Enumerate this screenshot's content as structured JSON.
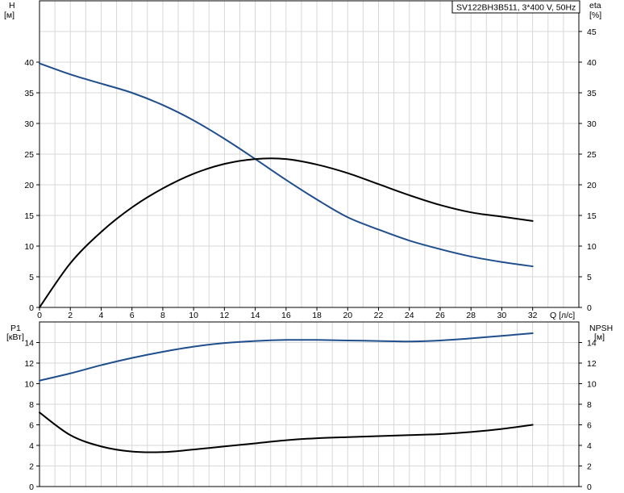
{
  "chart_data": [
    {
      "type": "line",
      "title": "SV122BH3B511, 3*400 V, 50Hz",
      "ylabel_left": "H",
      "ylabel_left_unit": "[м]",
      "ylabel_right": "eta",
      "ylabel_right_unit": "[%]",
      "xlabel": "Q [л/с]",
      "xlim": [
        0,
        35
      ],
      "ylim_left": [
        0,
        50
      ],
      "ylim_right": [
        0,
        50
      ],
      "x_ticks": [
        "0",
        "2",
        "4",
        "6",
        "8",
        "10",
        "12",
        "14",
        "16",
        "18",
        "20",
        "22",
        "24",
        "26",
        "28",
        "30",
        "32"
      ],
      "y_left_ticks": [
        "0",
        "5",
        "10",
        "15",
        "20",
        "25",
        "30",
        "35",
        "40"
      ],
      "y_right_ticks": [
        "0",
        "5",
        "10",
        "15",
        "20",
        "25",
        "30",
        "35",
        "40",
        "45"
      ],
      "grid": true,
      "series": [
        {
          "key": "H",
          "color": "#1f4e8c",
          "axis": "left",
          "x": [
            0,
            2,
            4,
            6,
            8,
            10,
            12,
            14,
            16,
            18,
            20,
            22,
            24,
            26,
            28,
            30,
            32
          ],
          "y": [
            39.8,
            38.0,
            36.5,
            35.0,
            33.0,
            30.5,
            27.5,
            24.2,
            20.8,
            17.6,
            14.7,
            12.7,
            10.9,
            9.5,
            8.3,
            7.4,
            6.7
          ]
        },
        {
          "key": "eta",
          "color": "#000000",
          "axis": "right",
          "x": [
            0,
            2,
            4,
            6,
            8,
            10,
            12,
            14,
            16,
            18,
            20,
            22,
            24,
            26,
            28,
            30,
            32
          ],
          "y": [
            0,
            7.2,
            12.3,
            16.3,
            19.4,
            21.8,
            23.4,
            24.2,
            24.2,
            23.3,
            21.9,
            20.1,
            18.3,
            16.7,
            15.5,
            14.8,
            14.1
          ]
        }
      ]
    },
    {
      "type": "line",
      "ylabel_left": "P1",
      "ylabel_left_unit": "[кВт]",
      "ylabel_right": "NPSH",
      "ylabel_right_unit": "[м]",
      "xlim": [
        0,
        35
      ],
      "ylim_left": [
        0,
        16
      ],
      "ylim_right": [
        0,
        16
      ],
      "y_left_ticks": [
        "0",
        "2",
        "4",
        "6",
        "8",
        "10",
        "12",
        "14"
      ],
      "y_right_ticks": [
        "0",
        "2",
        "4",
        "6",
        "8",
        "10",
        "12",
        "14"
      ],
      "grid": true,
      "series": [
        {
          "key": "P1",
          "color": "#1f4e8c",
          "axis": "left",
          "x": [
            0,
            2,
            4,
            6,
            8,
            10,
            12,
            14,
            16,
            18,
            20,
            22,
            24,
            26,
            28,
            30,
            32
          ],
          "y": [
            10.3,
            11.0,
            11.8,
            12.5,
            13.1,
            13.6,
            13.95,
            14.15,
            14.25,
            14.25,
            14.2,
            14.15,
            14.1,
            14.2,
            14.4,
            14.65,
            14.9
          ]
        },
        {
          "key": "NPSH",
          "color": "#000000",
          "axis": "right",
          "x": [
            0,
            2,
            4,
            6,
            8,
            10,
            12,
            14,
            16,
            18,
            20,
            22,
            24,
            26,
            28,
            30,
            32
          ],
          "y": [
            7.2,
            5.0,
            3.9,
            3.4,
            3.35,
            3.6,
            3.9,
            4.2,
            4.5,
            4.7,
            4.8,
            4.9,
            5.0,
            5.1,
            5.3,
            5.6,
            6.0
          ]
        }
      ]
    }
  ]
}
